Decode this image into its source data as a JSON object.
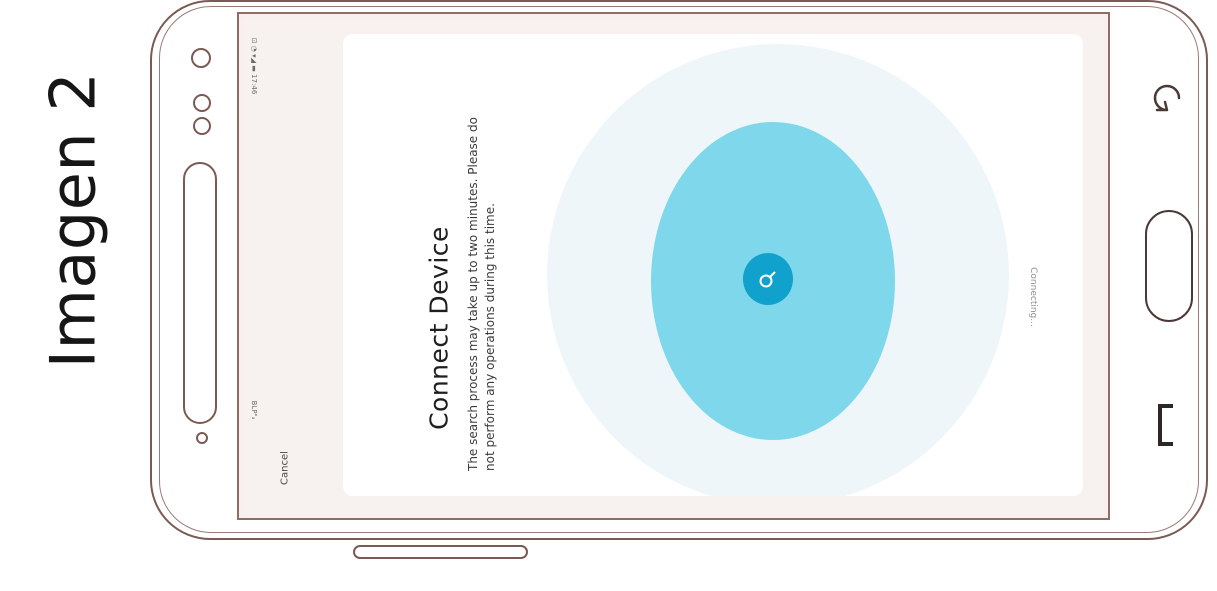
{
  "caption": "Imagen 2",
  "screen": {
    "status_bar": {
      "left": "BLP\"ₐ",
      "right": "⊡ ◔ ▾◢ ▬ 17:46"
    },
    "cancel_label": "Cancel",
    "title": "Connect Device",
    "description": "The search process may take up to two minutes. Please do not perform any operations during this time.",
    "status_text": "Connecting...",
    "search_icon": "search-icon"
  },
  "nav_buttons": {
    "back_icon": "back-icon",
    "home_icon": "home-icon",
    "recent_icon": "recent-apps-icon"
  },
  "colors": {
    "outline": "#7b5a53",
    "pulse_outer": "#eef6fa",
    "pulse_inner": "#7fd7ec",
    "search_button": "#10a2cc"
  }
}
